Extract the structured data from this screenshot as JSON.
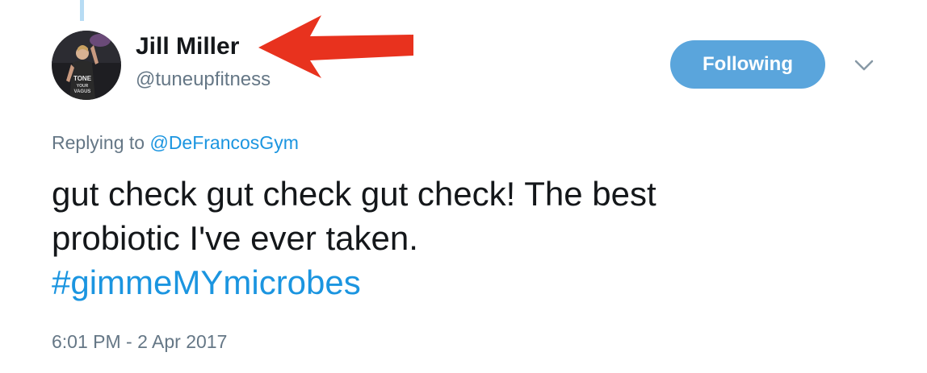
{
  "tweet": {
    "author": {
      "display_name": "Jill Miller",
      "handle": "@tuneupfitness",
      "avatar_shirt_text": [
        "TONE",
        "YOUR",
        "VAGUS"
      ]
    },
    "follow_button_label": "Following",
    "reply": {
      "prefix": "Replying to",
      "mention": "@DeFrancosGym"
    },
    "text_lines": [
      "gut check gut check gut check! The best",
      "probiotic I've ever taken."
    ],
    "hashtag": "#gimmeMYmicrobes",
    "timestamp": "6:01 PM - 2 Apr 2017"
  },
  "icons": {
    "more_menu": "chevron-down-icon",
    "annotation": "red-arrow-icon"
  },
  "colors": {
    "accent_blue": "#1b95e0",
    "button_blue": "#5aa5dc",
    "muted_text": "#657786",
    "primary_text": "#14171a",
    "arrow_red": "#e8321e",
    "thread_line": "#b7dcf4"
  }
}
